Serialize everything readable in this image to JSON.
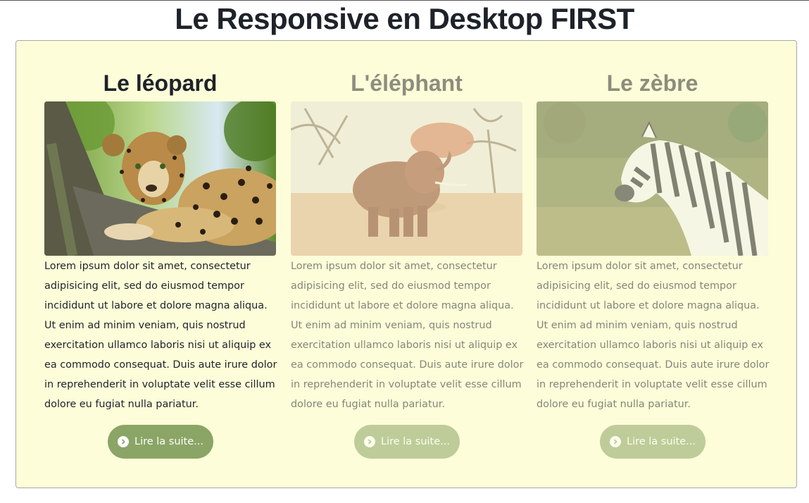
{
  "page": {
    "title": "Le Responsive en Desktop FIRST"
  },
  "cards": [
    {
      "title": "Le léopard",
      "text": "Lorem ipsum dolor sit amet, consectetur adipisicing elit, sed do eiusmod tempor incididunt ut labore et dolore magna aliqua. Ut enim ad minim veniam, quis nostrud exercitation ullamco laboris nisi ut aliquip ex ea commodo consequat. Duis aute irure dolor in reprehenderit in voluptate velit esse cillum dolore eu fugiat nulla pariatur.",
      "button_label": "Lire la suite...",
      "button_icon": "chevron-circle-right-icon",
      "image": "leopard-photo",
      "state": "active"
    },
    {
      "title": "L'éléphant",
      "text": "Lorem ipsum dolor sit amet, consectetur adipisicing elit, sed do eiusmod tempor incididunt ut labore et dolore magna aliqua. Ut enim ad minim veniam, quis nostrud exercitation ullamco laboris nisi ut aliquip ex ea commodo consequat. Duis aute irure dolor in reprehenderit in voluptate velit esse cillum dolore eu fugiat nulla pariatur.",
      "button_label": "Lire la suite...",
      "button_icon": "chevron-circle-right-icon",
      "image": "elephant-photo",
      "state": "faded"
    },
    {
      "title": "Le zèbre",
      "text": "Lorem ipsum dolor sit amet, consectetur adipisicing elit, sed do eiusmod tempor incididunt ut labore et dolore magna aliqua. Ut enim ad minim veniam, quis nostrud exercitation ullamco laboris nisi ut aliquip ex ea commodo consequat. Duis aute irure dolor in reprehenderit in voluptate velit esse cillum dolore eu fugiat nulla pariatur.",
      "button_label": "Lire la suite...",
      "button_icon": "chevron-circle-right-icon",
      "image": "zebra-photo",
      "state": "faded"
    }
  ],
  "colors": {
    "panel_background": "#fdfdd9",
    "button": "#8aa566",
    "title": "#1e2229"
  }
}
